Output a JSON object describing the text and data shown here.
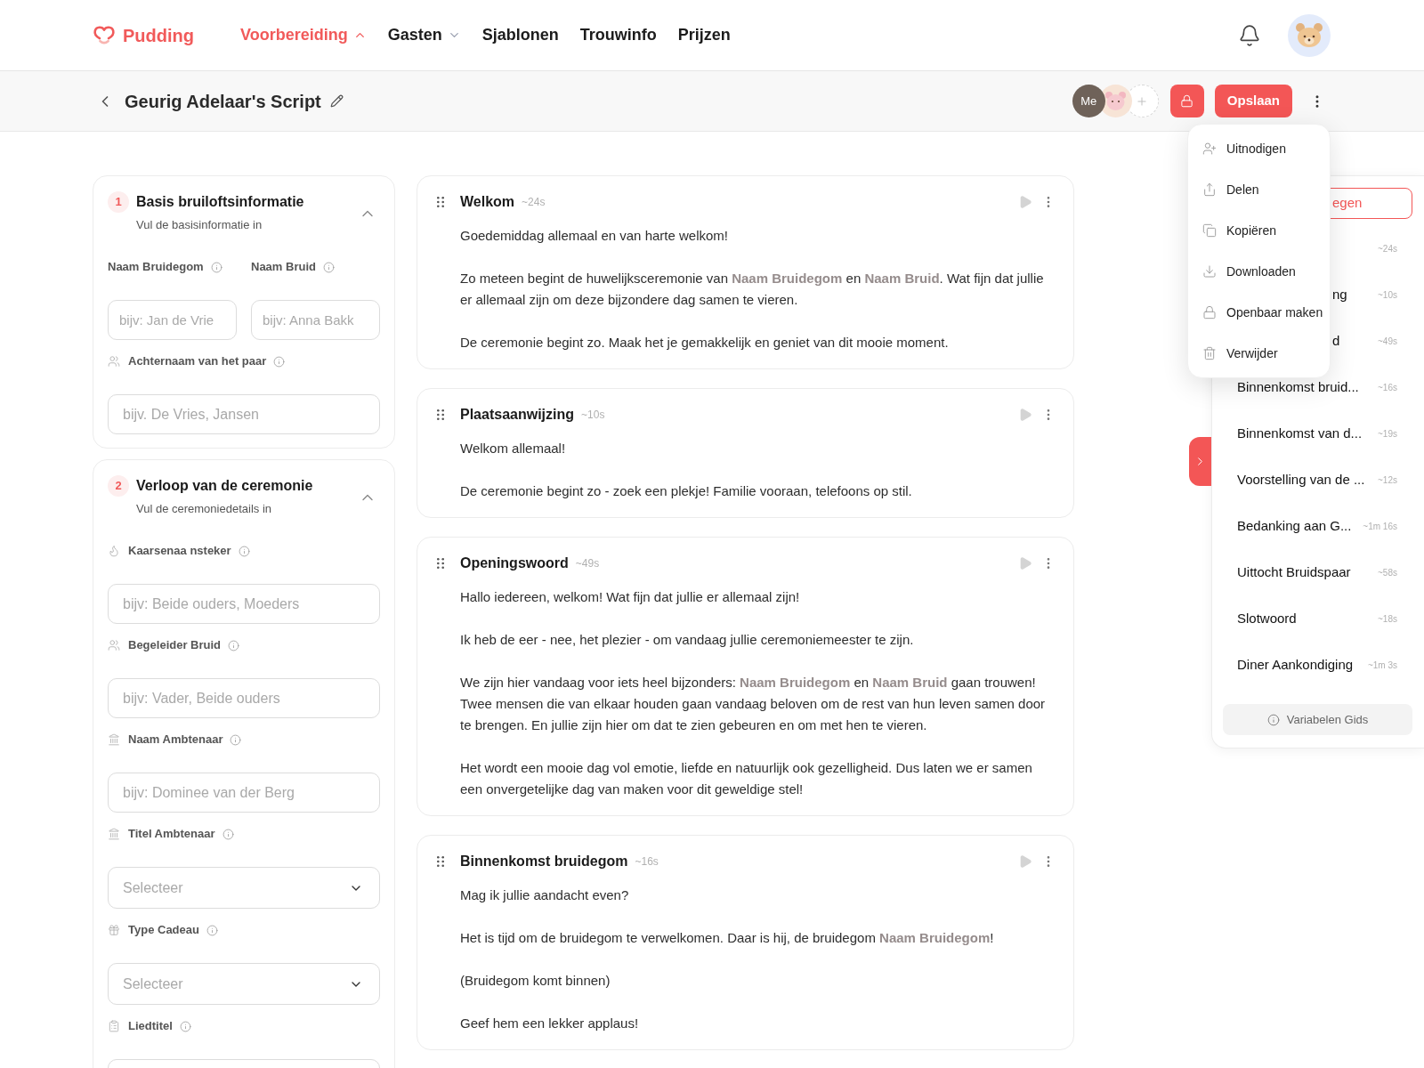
{
  "nav": {
    "logo": "Pudding",
    "items": [
      {
        "label": "Voorbereiding",
        "kind": "menu",
        "selected": true,
        "expanded": true
      },
      {
        "label": "Gasten",
        "kind": "menu",
        "selected": false,
        "expanded": false
      },
      {
        "label": "Sjablonen",
        "kind": "link",
        "selected": false
      },
      {
        "label": "Trouwinfo",
        "kind": "link",
        "selected": false
      },
      {
        "label": "Prijzen",
        "kind": "link",
        "selected": false
      }
    ]
  },
  "header": {
    "title": "Geurig Adelaar's Script",
    "me_avatar": "Me",
    "save_button": "Opslaan"
  },
  "more_menu": {
    "open": true,
    "items": [
      "Uitnodigen",
      "Delen",
      "Kopiëren",
      "Downloaden",
      "Openbaar maken",
      "Verwijder"
    ]
  },
  "form_sections": [
    {
      "number": "1",
      "title": "Basis bruiloftsinformatie",
      "subtitle": "Vul de basisinformatie in",
      "expanded": true,
      "field_rows": [
        [
          {
            "label": "Naam Bruidegom",
            "kind": "input",
            "placeholder": "bijv: Jan de Vrie"
          },
          {
            "label": "Naam Bruid",
            "kind": "input",
            "placeholder": "bijv: Anna Bakk"
          }
        ],
        [
          {
            "label": "Achternaam van het paar",
            "kind": "input",
            "placeholder": "bijv. De Vries, Jansen"
          }
        ]
      ]
    },
    {
      "number": "2",
      "title": "Verloop van de ceremonie",
      "subtitle": "Vul de ceremoniedetails in",
      "expanded": true,
      "field_rows": [
        [
          {
            "label": "Kaarsenaa nsteker",
            "kind": "input",
            "placeholder": "bijv: Beide ouders, Moeders"
          }
        ],
        [
          {
            "label": "Begeleider Bruid",
            "kind": "input",
            "placeholder": "bijv: Vader, Beide ouders"
          }
        ],
        [
          {
            "label": "Naam Ambtenaar",
            "kind": "input",
            "placeholder": "bijv: Dominee van der Berg"
          }
        ],
        [
          {
            "label": "Titel Ambtenaar",
            "kind": "select",
            "placeholder": "Selecteer"
          }
        ],
        [
          {
            "label": "Type Cadeau",
            "kind": "select",
            "placeholder": "Selecteer"
          }
        ],
        [
          {
            "label": "Liedtitel",
            "kind": "input"
          }
        ]
      ]
    }
  ],
  "script_sections": [
    {
      "title": "Welkom",
      "duration": "~24s",
      "paragraphs": [
        "Goedemiddag allemaal en van harte welkom!",
        "Zo meteen begint de huwelijksceremonie van **Naam Bruidegom** en **Naam Bruid**. Wat fijn dat jullie er allemaal zijn om deze bijzondere dag samen te vieren.",
        "De ceremonie begint zo. Maak het je gemakkelijk en geniet van dit mooie moment."
      ]
    },
    {
      "title": "Plaatsaanwijzing",
      "duration": "~10s",
      "paragraphs": [
        "Welkom allemaal!",
        "De ceremonie begint zo - zoek een plekje! Familie vooraan, telefoons op stil."
      ]
    },
    {
      "title": "Openingswoord",
      "duration": "~49s",
      "paragraphs": [
        "Hallo iedereen, welkom! Wat fijn dat jullie er allemaal zijn!",
        "Ik heb de eer - nee, het plezier - om vandaag jullie ceremoniemeester te zijn.",
        "We zijn hier vandaag voor iets heel bijzonders: **Naam Bruidegom** en **Naam Bruid** gaan trouwen! Twee mensen die van elkaar houden gaan vandaag beloven om de rest van hun leven samen door te brengen. En jullie zijn hier om dat te zien gebeuren en om met hen te vieren.",
        "Het wordt een mooie dag vol emotie, liefde en natuurlijk ook gezelligheid. Dus laten we er samen een onvergetelijke dag van maken voor dit geweldige stel!"
      ]
    },
    {
      "title": "Binnenkomst bruidegom",
      "duration": "~16s",
      "paragraphs": [
        "Mag ik jullie aandacht even?",
        "Het is tijd om de bruidegom te verwelkomen. Daar is hij, de bruidegom **Naam Bruidegom**!",
        "(Bruidegom komt binnen)",
        "Geef hem een lekker applaus!"
      ]
    }
  ],
  "outline": {
    "add_button": "egen",
    "items": [
      {
        "duration": "~24s"
      },
      {
        "title": "ng",
        "duration": "~10s"
      },
      {
        "title": "d",
        "duration": "~49s"
      },
      {
        "title": "Binnenkomst bruid...",
        "duration": "~16s"
      },
      {
        "title": "Binnenkomst van d...",
        "duration": "~19s"
      },
      {
        "title": "Voorstelling van de ...",
        "duration": "~12s"
      },
      {
        "title": "Bedanking aan G...",
        "duration": "~1m 16s"
      },
      {
        "title": "Uittocht Bruidspaar",
        "duration": "~58s"
      },
      {
        "title": "Slotwoord",
        "duration": "~18s"
      },
      {
        "title": "Diner Aankondiging",
        "duration": "~1m 3s"
      }
    ],
    "guide_button": "Variabelen Gids"
  }
}
